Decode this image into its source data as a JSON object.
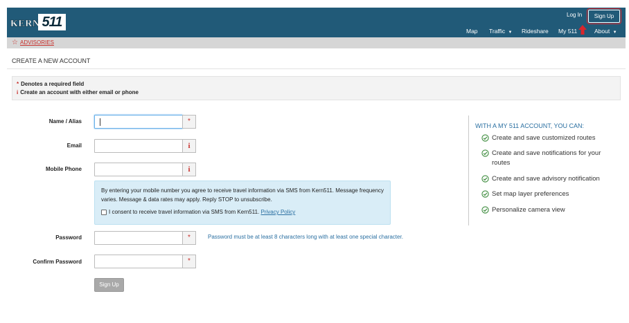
{
  "header": {
    "logo_word": "KERN",
    "logo_number": "511",
    "login_label": "Log In",
    "signup_label": "Sign Up",
    "nav": [
      {
        "label": "Map"
      },
      {
        "label": "Traffic",
        "caret": "▲"
      },
      {
        "label": "Rideshare"
      },
      {
        "label": "My 511"
      },
      {
        "label": "About",
        "caret": "▲"
      }
    ]
  },
  "advisories": {
    "label": "ADVISORIES",
    "icon": "star-outline-icon"
  },
  "page": {
    "title": "CREATE A NEW ACCOUNT"
  },
  "notice": {
    "required_mark": "*",
    "required_text": "Denotes a required field",
    "info_mark": "i",
    "info_text": "Create an account with either email or phone"
  },
  "form": {
    "name_label": "Name / Alias",
    "email_label": "Email",
    "phone_label": "Mobile Phone",
    "required_symbol": "*",
    "info_symbol": "i",
    "sms_text": "By entering your mobile number you agree to receive travel information via SMS from Kern511. Message frequency varies. Message & data rates may apply. Reply STOP to unsubscribe.",
    "consent_text": "I consent to receive travel information via SMS from Kern511.",
    "privacy_link": "Privacy Policy",
    "password_label": "Password",
    "password_hint": "Password must be at least 8 characters long with at least one special character.",
    "confirm_label": "Confirm Password",
    "submit_label": "Sign Up"
  },
  "benefits": {
    "title": "WITH A MY 511 ACCOUNT, YOU CAN:",
    "items": [
      "Create and save customized routes",
      "Create and save notifications for your routes",
      "Create and save advisory notification",
      "Set map layer preferences",
      "Personalize camera view"
    ]
  },
  "colors": {
    "header_bg": "#215a78",
    "accent_red": "#c9302c",
    "link_blue": "#2a6fa1",
    "check_green": "#3c8b3c",
    "sms_box_bg": "#d9edf7"
  }
}
